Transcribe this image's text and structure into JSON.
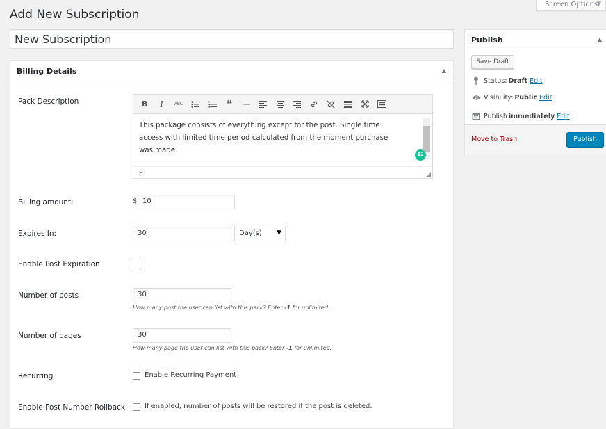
{
  "screen_options": {
    "label": "Screen Options",
    "arrow": "▼"
  },
  "page_title": "Add New Subscription",
  "title_field": {
    "value": "New Subscription"
  },
  "billing": {
    "heading": "Billing Details",
    "toggle_icon": "▲",
    "pack_description_label": "Pack Description",
    "editor": {
      "toolbar_icons": [
        "bold-icon",
        "italic-icon",
        "strikethrough-icon",
        "bulleted-list-icon",
        "numbered-list-icon",
        "blockquote-icon",
        "horizontal-line-icon",
        "align-left-icon",
        "align-center-icon",
        "align-right-icon",
        "insert-link-icon",
        "remove-link-icon",
        "read-more-icon",
        "fullscreen-icon",
        "toolbar-toggle-icon"
      ],
      "bold": "B",
      "italic": "I",
      "strike": "ABC",
      "quote": "❝",
      "content": "This package consists of everything except for the post. Single time access  with limited time period calculated from the moment purchase was made.",
      "path": "p",
      "grammarly": "G"
    },
    "billing_amount_label": "Billing amount:",
    "currency": "$",
    "billing_amount_value": "10",
    "expires_label": "Expires In:",
    "expires_value": "30",
    "expires_unit": "Day(s)",
    "expires_caret": "▼",
    "post_expiration_label": "Enable Post Expiration",
    "num_posts_label": "Number of posts",
    "num_posts_value": "30",
    "num_posts_help_pre": "How many post the user can list with this pack? Enter ",
    "num_posts_help_bold": "-1",
    "num_posts_help_post": " for unlimited.",
    "num_pages_label": "Number of pages",
    "num_pages_value": "30",
    "num_pages_help_pre": "How many page the user can list with this pack? Enter ",
    "num_pages_help_bold": "-1",
    "num_pages_help_post": " for unlimited.",
    "recurring_label": "Recurring",
    "recurring_checkbox_label": "Enable Recurring Payment",
    "rollback_label": "Enable Post Number Rollback",
    "rollback_checkbox_label": "If enabled, number of posts will be restored if the post is deleted."
  },
  "publish": {
    "heading": "Publish",
    "toggle_icon": "▲",
    "save_draft": "Save Draft",
    "status_label": "Status:",
    "status_value": "Draft",
    "visibility_label": "Visibility:",
    "visibility_value": "Public",
    "schedule_label": "Publish",
    "schedule_value": "immediately",
    "edit": "Edit",
    "trash": "Move to Trash",
    "publish_button": "Publish"
  },
  "colors": {
    "primary": "#0085ba",
    "link": "#0073aa",
    "trash": "#a00",
    "grammarly": "#15c39a"
  }
}
